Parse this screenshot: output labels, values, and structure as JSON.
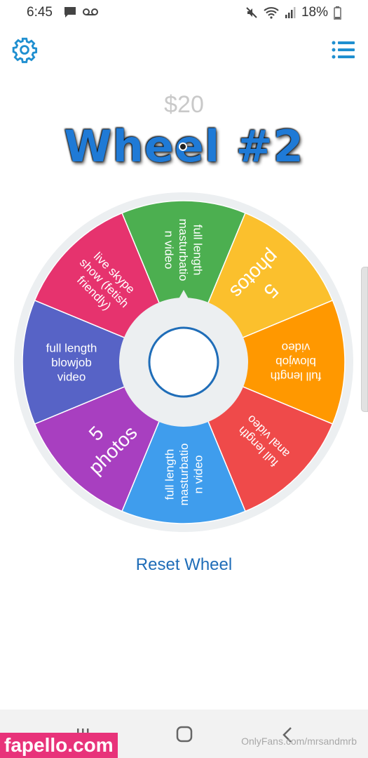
{
  "status_bar": {
    "time": "6:45",
    "battery": "18%",
    "icons": [
      "message-icon",
      "voicemail-icon",
      "mute-icon",
      "wifi-icon",
      "signal-icon",
      "battery-icon"
    ]
  },
  "header": {
    "settings_icon": "gear-icon",
    "menu_icon": "list-icon",
    "accent_color": "#1f8fd0"
  },
  "wheel": {
    "price": "$20",
    "title": "Wheel #2",
    "segments": [
      {
        "lines": [
          "full length",
          "masturbatio",
          "n video"
        ],
        "color": "#4caf50"
      },
      {
        "lines": [
          "5",
          "photos"
        ],
        "color": "#fbc02d"
      },
      {
        "lines": [
          "full length",
          "blowjob",
          "video"
        ],
        "color": "#ff9800"
      },
      {
        "lines": [
          "full length",
          "anal video"
        ],
        "color": "#ef4a4a"
      },
      {
        "lines": [
          "full length",
          "masturbatio",
          "n video"
        ],
        "color": "#3f9ded"
      },
      {
        "lines": [
          "5",
          "photos"
        ],
        "color": "#a83fc0"
      },
      {
        "lines": [
          "full length",
          "blowjob",
          "video"
        ],
        "color": "#5763c6"
      },
      {
        "lines": [
          "live skype",
          "show (fetish",
          "friendly)"
        ],
        "color": "#e6336e"
      }
    ]
  },
  "actions": {
    "reset_label": "Reset Wheel"
  },
  "watermarks": {
    "left": "fapello.com",
    "right": "OnlyFans.com/mrsandmrb"
  }
}
